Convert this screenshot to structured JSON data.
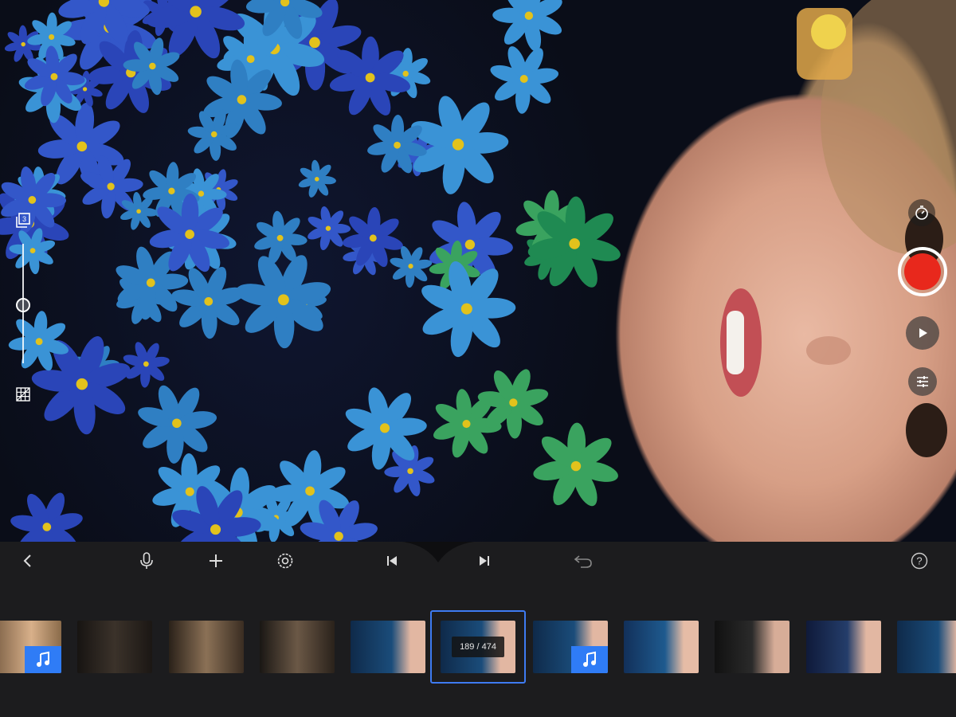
{
  "preview": {
    "description_icons": [
      "onion-skin-icon",
      "zoom-slider",
      "grid-icon"
    ],
    "onion_skin_count": "3",
    "zoom_level_fraction": 0.45
  },
  "right_controls": {
    "timer_icon": "timer-icon",
    "record_color": "#e8281c",
    "play_icon": "play-icon",
    "adjust_icon": "sliders-icon"
  },
  "toolbar": {
    "items": [
      "back-icon",
      "microphone-icon",
      "plus-icon",
      "settings-icon",
      "skip-start-icon",
      "skip-end-icon",
      "undo-icon",
      "help-icon"
    ]
  },
  "timeline": {
    "frame_counter": "189 / 474",
    "selected_index": 5,
    "accent": "#3e7bf2",
    "music_badge_color": "#2f7cf6",
    "clips": [
      {
        "name": "clip-1",
        "music": true
      },
      {
        "name": "clip-2",
        "music": false
      },
      {
        "name": "clip-3",
        "music": false
      },
      {
        "name": "clip-4",
        "music": false
      },
      {
        "name": "clip-5",
        "music": false
      },
      {
        "name": "clip-6",
        "music": false
      },
      {
        "name": "clip-7",
        "music": true
      },
      {
        "name": "clip-8",
        "music": false
      },
      {
        "name": "clip-9",
        "music": false
      },
      {
        "name": "clip-10",
        "music": false
      },
      {
        "name": "clip-11",
        "music": false
      }
    ]
  }
}
